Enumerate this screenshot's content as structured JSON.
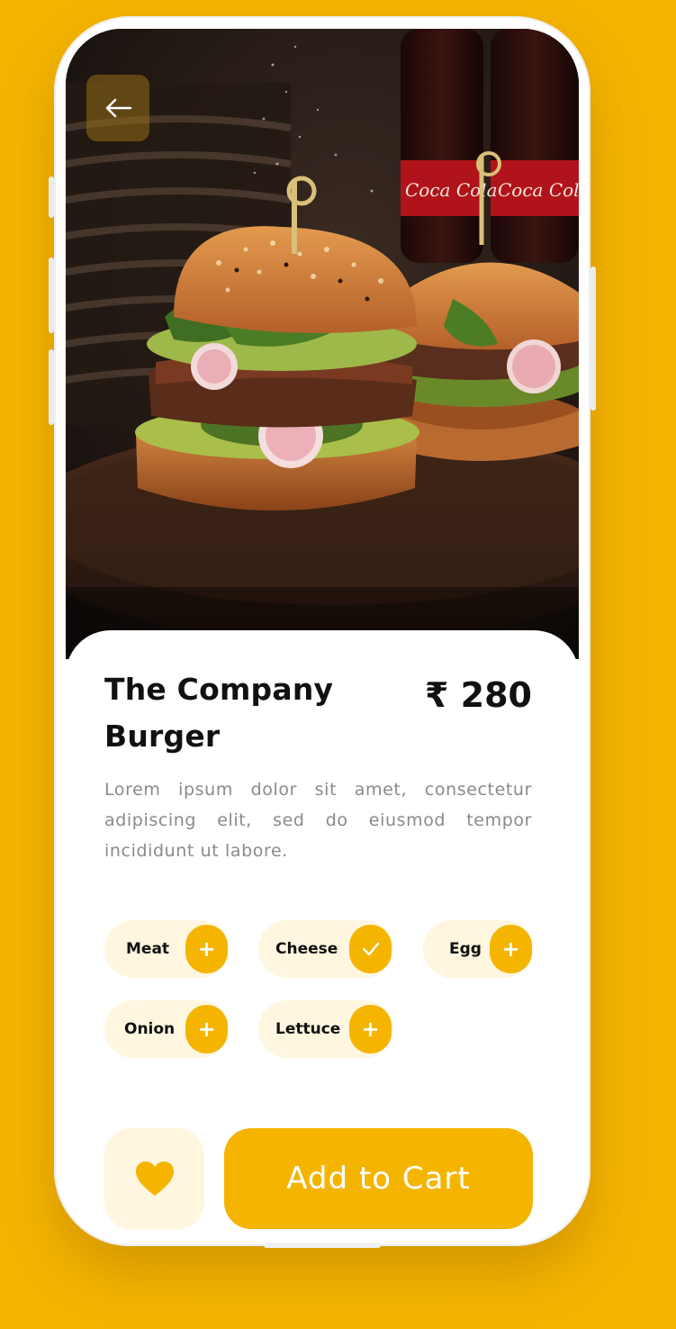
{
  "theme": {
    "accent": "#F5B400",
    "chip_bg": "#FFF6E0",
    "text_dark": "#111111",
    "text_muted": "#8a8a8a"
  },
  "header": {
    "back_icon": "arrow-left-icon"
  },
  "product": {
    "name": "The Company Burger",
    "price": "₹ 280",
    "description": "Lorem ipsum dolor sit amet, consectetur adipiscing elit, sed do eiusmod tempor incididunt ut labore.",
    "photo_label": "Coca Cola"
  },
  "addons": [
    {
      "label": "Meat",
      "selected": false,
      "icon": "plus-icon"
    },
    {
      "label": "Cheese",
      "selected": true,
      "icon": "check-icon"
    },
    {
      "label": "Egg",
      "selected": false,
      "icon": "plus-icon"
    },
    {
      "label": "Onion",
      "selected": false,
      "icon": "plus-icon"
    },
    {
      "label": "Lettuce",
      "selected": false,
      "icon": "plus-icon"
    }
  ],
  "actions": {
    "favorite_icon": "heart-icon",
    "add_to_cart_label": "Add to Cart"
  }
}
